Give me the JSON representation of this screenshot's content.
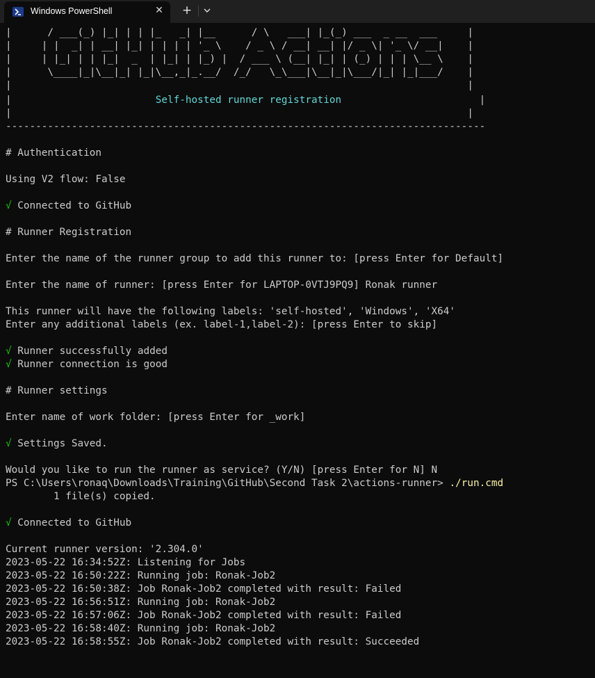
{
  "window": {
    "tab_title": "Windows PowerShell",
    "close_glyph": "✕",
    "new_tab_glyph": "+",
    "icons": [
      "powershell-icon",
      "close-icon",
      "plus-icon",
      "chevron-down-icon"
    ]
  },
  "colors": {
    "background": "#0c0c0c",
    "text": "#cccccc",
    "teal": "#61d6d6",
    "green_check": "#16c60c",
    "command": "#f9f1a5"
  },
  "banner": {
    "art": [
      "|      / ___(_) |_| | | |_   _| |__      / \\   ___| |_(_) ___  _ __  ___     |",
      "|     | |  _| | __| |_| | | | | '_ \\    / _ \\ / __| __| |/ _ \\| '_ \\/ __|    |",
      "|     | |_| | | |_|  _  | |_| | |_) |  / ___ \\ (__| |_| | (_) | | | \\__ \\    |",
      "|      \\____|_|\\__|_| |_|\\__,_|_.__/  /_/   \\_\\___|\\__|_|\\___/|_| |_|___/    |",
      "|                                                                            |"
    ],
    "subtitle_prefix": "|                        ",
    "subtitle": "Self-hosted runner registration",
    "subtitle_suffix": "                       |",
    "blank": "|                                                                            |",
    "rule": "--------------------------------------------------------------------------------"
  },
  "output": {
    "auth_header": "# Authentication",
    "v2_flow": "Using V2 flow: False",
    "check": "√",
    "connected": " Connected to GitHub",
    "reg_header": "# Runner Registration",
    "group_prompt": "Enter the name of the runner group to add this runner to: [press Enter for Default]",
    "name_prompt": "Enter the name of runner: [press Enter for LAPTOP-0VTJ9PQ9] Ronak runner",
    "labels_info": "This runner will have the following labels: 'self-hosted', 'Windows', 'X64'",
    "labels_prompt": "Enter any additional labels (ex. label-1,label-2): [press Enter to skip]",
    "added": " Runner successfully added",
    "conn_good": " Runner connection is good",
    "settings_header": "# Runner settings",
    "work_folder": "Enter name of work folder: [press Enter for _work]",
    "saved": " Settings Saved.",
    "service_prompt": "Would you like to run the runner as service? (Y/N) [press Enter for N] N",
    "ps_prompt": "PS C:\\Users\\ronaq\\Downloads\\Training\\GitHub\\Second Task 2\\actions-runner> ",
    "command": "./run.cmd",
    "copied": "        1 file(s) copied.",
    "version": "Current runner version: '2.304.0'",
    "log": [
      "2023-05-22 16:34:52Z: Listening for Jobs",
      "2023-05-22 16:50:22Z: Running job: Ronak-Job2",
      "2023-05-22 16:50:38Z: Job Ronak-Job2 completed with result: Failed",
      "2023-05-22 16:56:51Z: Running job: Ronak-Job2",
      "2023-05-22 16:57:06Z: Job Ronak-Job2 completed with result: Failed",
      "2023-05-22 16:58:40Z: Running job: Ronak-Job2",
      "2023-05-22 16:58:55Z: Job Ronak-Job2 completed with result: Succeeded"
    ]
  }
}
